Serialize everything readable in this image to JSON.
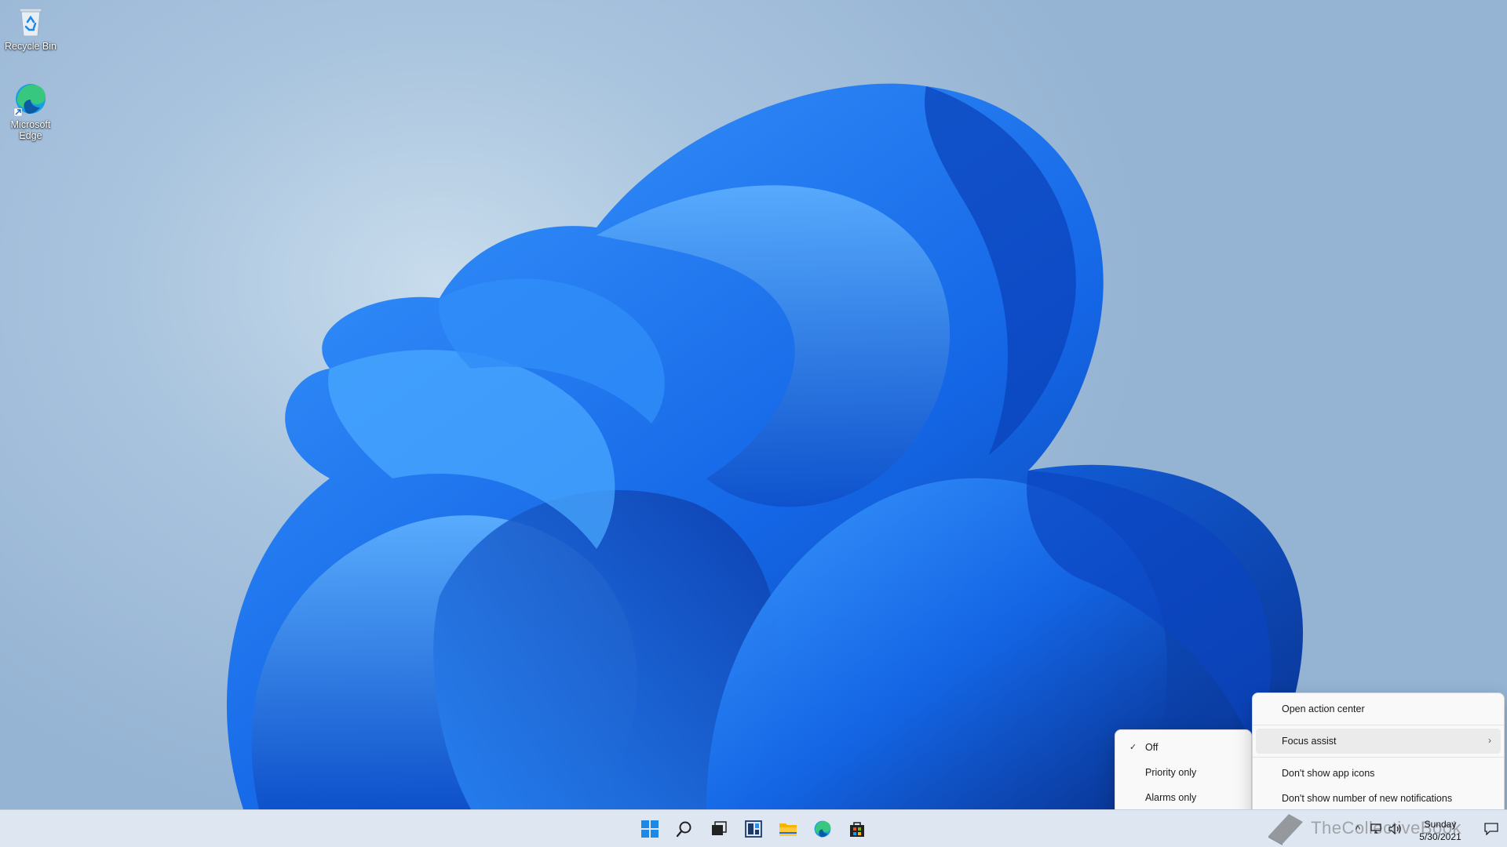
{
  "desktop": {
    "icons": [
      {
        "label": "Recycle Bin",
        "icon": "recycle-bin-icon"
      },
      {
        "label": "Microsoft Edge",
        "icon": "edge-icon"
      }
    ]
  },
  "taskbar": {
    "apps": [
      {
        "name": "Start",
        "icon": "windows-start-icon"
      },
      {
        "name": "Search",
        "icon": "search-icon"
      },
      {
        "name": "Task View",
        "icon": "task-view-icon"
      },
      {
        "name": "Widgets",
        "icon": "widgets-icon"
      },
      {
        "name": "File Explorer",
        "icon": "file-explorer-icon"
      },
      {
        "name": "Microsoft Edge",
        "icon": "edge-icon"
      },
      {
        "name": "Microsoft Store",
        "icon": "store-icon"
      }
    ],
    "tray": {
      "chevron": "^",
      "clock_day": "Sunday",
      "clock_date": "5/30/2021"
    },
    "watermark_text": "TheCollectiveBook"
  },
  "context_menu": {
    "items": [
      {
        "label": "Open action center"
      },
      {
        "label": "Focus assist",
        "has_submenu": true,
        "highlighted": true
      },
      {
        "label": "Don't show app icons"
      },
      {
        "label": "Don't show number of new notifications"
      }
    ]
  },
  "focus_assist_submenu": {
    "items": [
      {
        "label": "Off",
        "checked": true
      },
      {
        "label": "Priority only",
        "checked": false
      },
      {
        "label": "Alarms only",
        "checked": false
      }
    ]
  },
  "colors": {
    "accent": "#0067c0",
    "bloom_blue": "#1a6fe0",
    "taskbar_bg": "#dde6f1",
    "menu_bg": "#f9f9f9"
  }
}
